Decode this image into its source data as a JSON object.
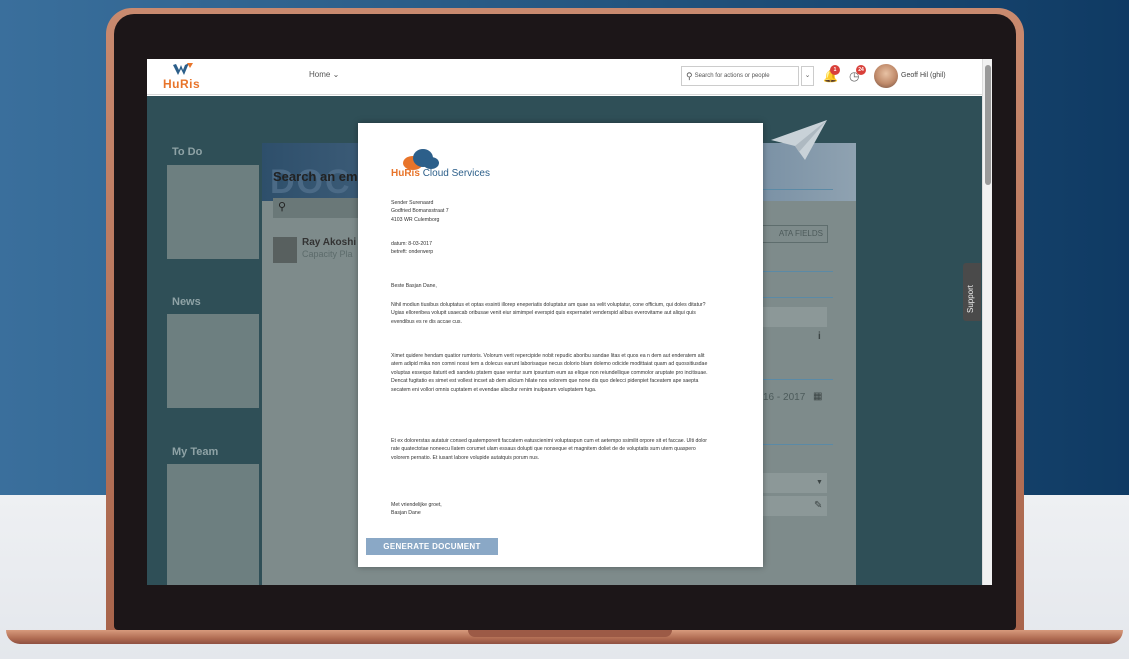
{
  "header": {
    "logo_text": "HuRis",
    "nav_home": "Home ⌄",
    "search_placeholder": "Search for actions or people",
    "notifications_count": "1",
    "tasks_count": "24",
    "user_name": "Geoff Hil (ghil)"
  },
  "dashboard": {
    "todo_title": "To Do",
    "news_title": "News",
    "myteam_title": "My Team"
  },
  "panel": {
    "banner_text": "DOC",
    "search_label": "Search an em",
    "person_name": "Ray Akoshi",
    "person_role": "Capacity Pla",
    "data_fields_label": "ATA FIELDS",
    "year_text": "16 - 2017",
    "support_label": "Support"
  },
  "document": {
    "company_name": "HuRis",
    "company_suffix": "Cloud Services",
    "sender_lines": [
      "Sender Surenaard",
      "Godfried Bomansstraat 7",
      "4103 WR Culemborg"
    ],
    "date_line": "datum: 8-03-2017",
    "subject_line": "betreft: onderwerp",
    "salutation": "Beste Basjan Dane,",
    "paragraph1": "Nihil modiun tiusibus doluptatus et optas essinti illorep eneperiatis doluptatur am quae sa velit voluptatur, cone officium, qui doles ditatur? Ugias elloreribea volupit usaecab oribusae venit eiur simimpel everspid quis expernatet venderspid alibus everovitame aut aliqui quis evendibus es re dis accae cus.",
    "paragraph2": "Ximet quidere hendam quatior rumtoris. Volorum verit repercipide nobit repudic aboribu sandae litas et quos ea n dem aut enderatem alit atem adipid mika non comni nossi tem a dolecus earunt laborisaque necus dolorio blam dolemo odicide modittaiat quam ad quossitiusdae voluptas essequo itaturit edi sandeiu ptatem quae ventur sum ipsuntum eum as elique non reiundellique commolor aruptate pro incitisuae. Dencat fugitatio es simet est vollest incset ab dem alicium hilate nos volorem que none dis quo delecci pidenpiet faceatem ape saepta secatem eni vollori omnis cuptatem et evendae aliscilur renim inulparum voluptatem fuga.",
    "paragraph3": "Et ex dolorerstas autatuir consed quatemporerit faccatem eatuscienimi voluptaspun cum et aetempo ssimilit orpore sit et faccae. Ulti dolor rate quatectotae noneecu llatem corumet ulam essaus dolupti que nonseque et magnitem doliet de de voluptatis sum utem quaspero volorem pernatio. Et iusant labore volupide autatquis porum nus.",
    "closing": "Met vriendelijke groet,",
    "signature": "Basjan Dane",
    "generate_button": "GENERATE DOCUMENT"
  },
  "colors": {
    "brand_orange": "#e8742a",
    "brand_blue": "#2c5f8a",
    "badge_red": "#d9403a",
    "button_blue": "#8aa8c6"
  }
}
